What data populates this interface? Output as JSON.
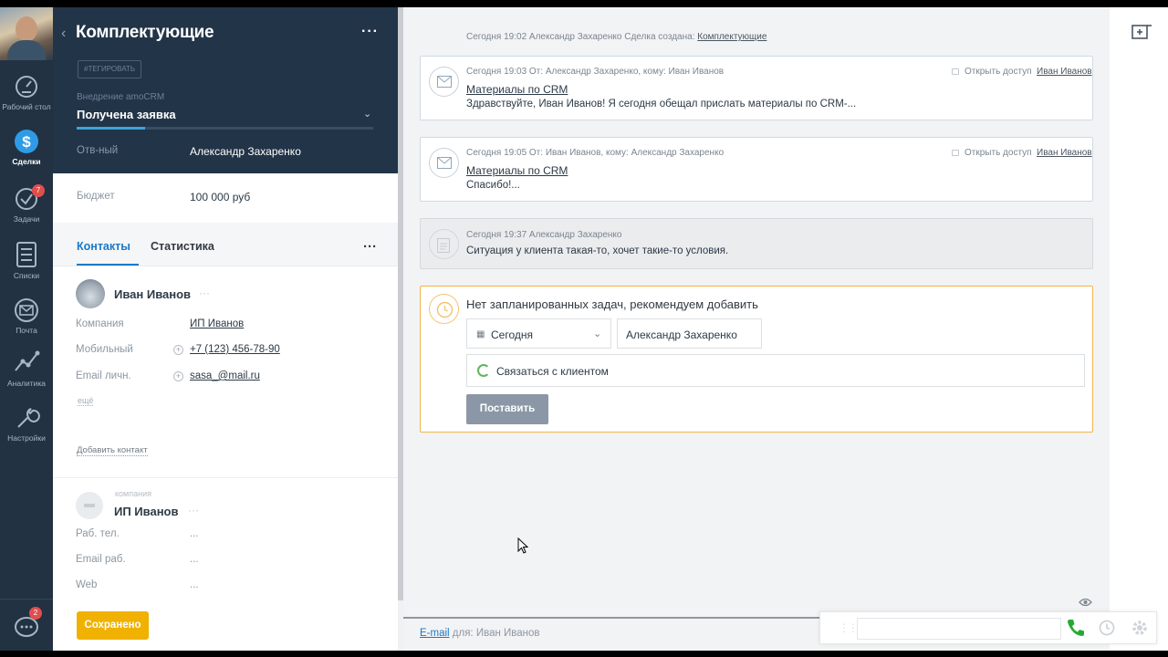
{
  "nav": {
    "items": [
      {
        "label": "Рабочий стол",
        "icon": "gauge-icon"
      },
      {
        "label": "Сделки",
        "icon": "dollar-icon",
        "active": true
      },
      {
        "label": "Задачи",
        "icon": "check-icon",
        "badge": "7"
      },
      {
        "label": "Списки",
        "icon": "list-icon"
      },
      {
        "label": "Почта",
        "icon": "mail-icon"
      },
      {
        "label": "Аналитика",
        "icon": "chart-icon"
      },
      {
        "label": "Настройки",
        "icon": "wrench-icon"
      }
    ],
    "chat_badge": "2"
  },
  "card": {
    "title": "Комплектующие",
    "tag_button": "#ТЕГИРОВАТЬ",
    "pipeline": "Внедрение amoCRM",
    "stage": "Получена заявка",
    "stage_progress": 0.23,
    "responsible_label": "Отв-ный",
    "responsible_value": "Александр Захаренко",
    "budget_label": "Бюджет",
    "budget_value": "100 000  руб",
    "tabs": [
      "Контакты",
      "Статистика"
    ],
    "contact": {
      "name": "Иван Иванов",
      "fields": [
        {
          "label": "Компания",
          "value": "ИП Иванов"
        },
        {
          "label": "Мобильный",
          "value": "+7 (123) 456-78-90"
        },
        {
          "label": "Email личн.",
          "value": "sasa_@mail.ru"
        }
      ],
      "more": "ещё"
    },
    "add_contact": "Добавить контакт",
    "company": {
      "caption": "компания",
      "name": "ИП Иванов",
      "fields": [
        {
          "label": "Раб. тел.",
          "value": "..."
        },
        {
          "label": "Email раб.",
          "value": "..."
        },
        {
          "label": "Web",
          "value": "..."
        }
      ]
    },
    "saved_button": "Сохранено"
  },
  "feed": {
    "created": {
      "meta": "Сегодня 19:02 Александр Захаренко  Сделка создана:",
      "link": "Комплектующие"
    },
    "notes": [
      {
        "meta": "Сегодня 19:03 От: Александр Захаренко, кому: Иван Иванов",
        "subject": "Материалы по CRM",
        "body": "Здравствуйте, Иван Иванов! Я сегодня обещал прислать материалы по CRM-...",
        "access": "Открыть доступ",
        "to": "Иван Иванов"
      },
      {
        "meta": "Сегодня 19:05 От: Иван Иванов, кому: Александр Захаренко",
        "subject": "Материалы по CRM",
        "body": "Спасибо!...",
        "access": "Открыть доступ",
        "to": "Иван Иванов"
      },
      {
        "meta": "Сегодня 19:37 Александр Захаренко",
        "body": "Ситуация у клиента такая-то, хочет такие-то условия."
      }
    ],
    "task": {
      "title": "Нет запланированных задач, рекомендуем добавить",
      "date": "Сегодня",
      "user": "Александр Захаренко",
      "type": "Связаться с клиентом",
      "button": "Поставить"
    },
    "email_link": "E-mail",
    "email_for": " для: Иван Иванов"
  },
  "colors": {
    "nav_bg": "#223242",
    "accent": "#1b79c7",
    "saved": "#f0b100",
    "task_border": "#f1b54b"
  }
}
